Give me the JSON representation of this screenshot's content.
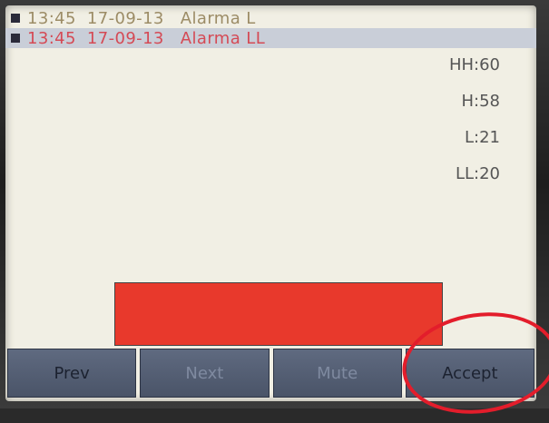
{
  "alarms": [
    {
      "time": "13:45",
      "date": "17-09-13",
      "label": "Alarma L"
    },
    {
      "time": "13:45",
      "date": "17-09-13",
      "label": "Alarma LL"
    }
  ],
  "limits": {
    "hh": "HH:60",
    "h": "H:58",
    "l": "L:21",
    "ll": "LL:20"
  },
  "level": {
    "fill_fraction": 1.0,
    "color": "#e8392c"
  },
  "buttons": {
    "prev": "Prev",
    "next": "Next",
    "mute": "Mute",
    "accept": "Accept"
  },
  "colors": {
    "screen_bg": "#f1efe4",
    "alarm_l": "#9c8c66",
    "alarm_ll": "#d54a55",
    "selected_row": "#c9ced8",
    "annotation_ring": "#e31d2b"
  },
  "icons": {
    "row_marker": "square-bullet-icon"
  }
}
